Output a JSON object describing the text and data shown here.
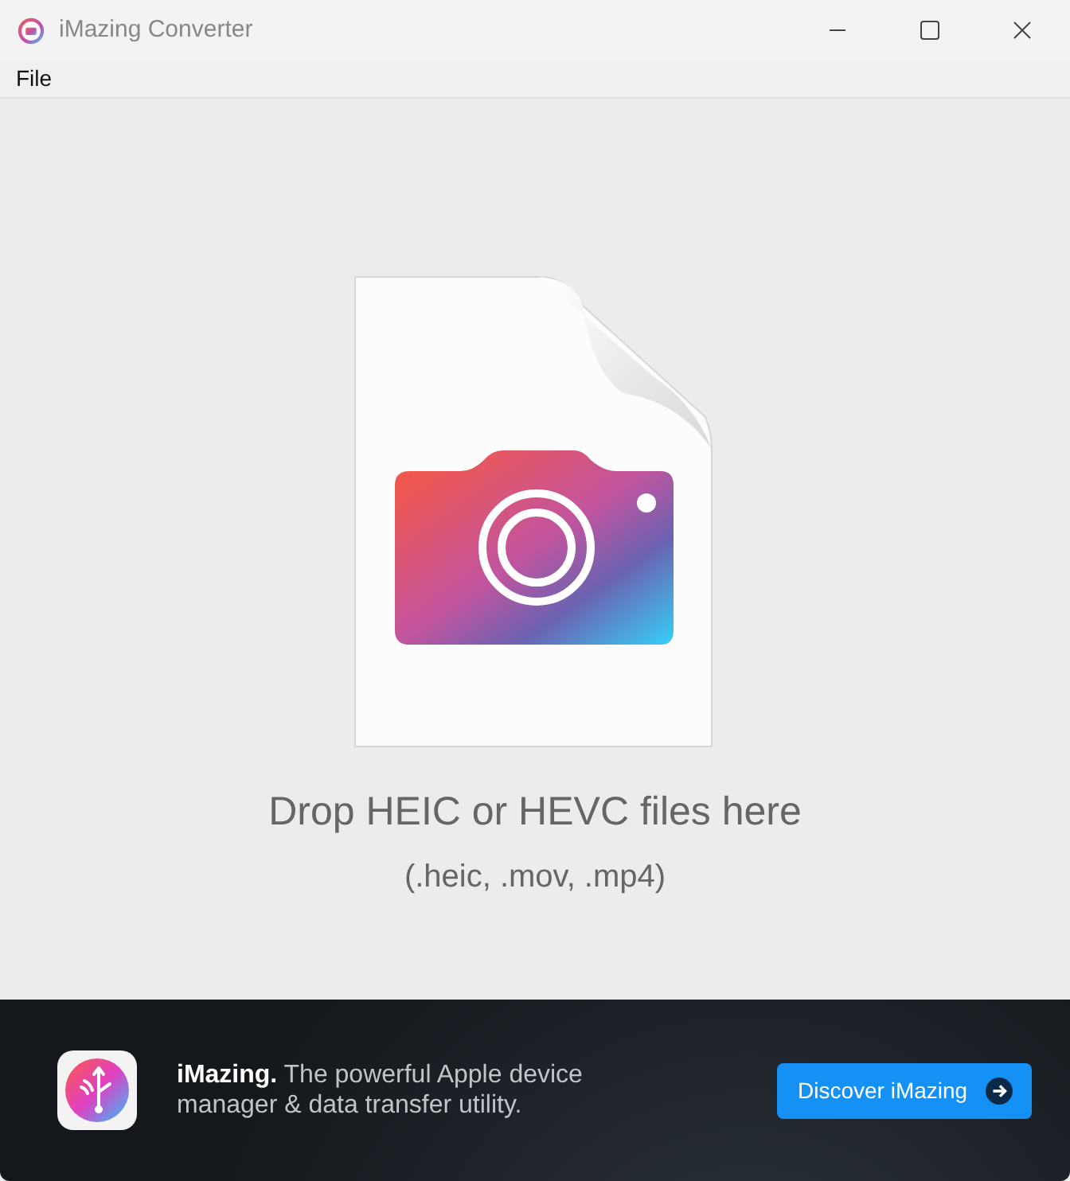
{
  "window": {
    "title": "iMazing Converter"
  },
  "menu": [
    "File"
  ],
  "drop": {
    "title": "Drop HEIC or HEVC files here",
    "subtitle": "(.heic, .mov, .mp4)"
  },
  "banner": {
    "text": "**iMazing.** The powerful Apple device manager & data transfer utility.",
    "button": "Discover iMazing"
  }
}
